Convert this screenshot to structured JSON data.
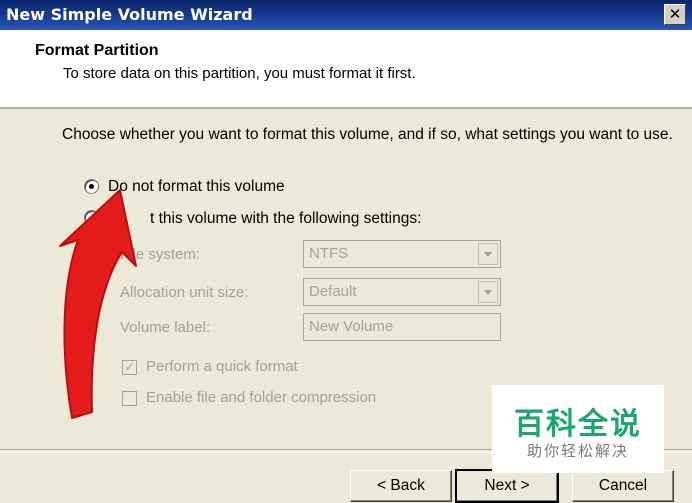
{
  "window": {
    "title": "New Simple Volume Wizard",
    "close_glyph": "✕"
  },
  "header": {
    "title": "Format Partition",
    "subtitle": "To store data on this partition, you must format it first."
  },
  "instruction": "Choose whether you want to format this volume, and if so, what settings you want to use.",
  "options": {
    "no_format": {
      "label": "Do not format this volume",
      "selected": true
    },
    "format_with": {
      "label": "t this volume with the following settings:",
      "selected": false
    }
  },
  "settings": {
    "file_system": {
      "label": "File system:",
      "value": "NTFS"
    },
    "allocation": {
      "label": "Allocation unit size:",
      "value": "Default"
    },
    "volume_label": {
      "label": "Volume label:",
      "value": "New Volume"
    },
    "quick_format": {
      "label": "Perform a quick format",
      "checked": true,
      "glyph": "✓"
    },
    "compression": {
      "label": "Enable file and folder compression",
      "checked": false
    }
  },
  "buttons": {
    "back": "< Back",
    "next": "Next >",
    "cancel": "Cancel"
  },
  "annotation": {
    "icon": "red-arrow-icon",
    "color": "#e41b1b"
  },
  "watermark": {
    "title": "百科全说",
    "subtitle": "助你轻松解决",
    "color": "#1aa66e"
  }
}
